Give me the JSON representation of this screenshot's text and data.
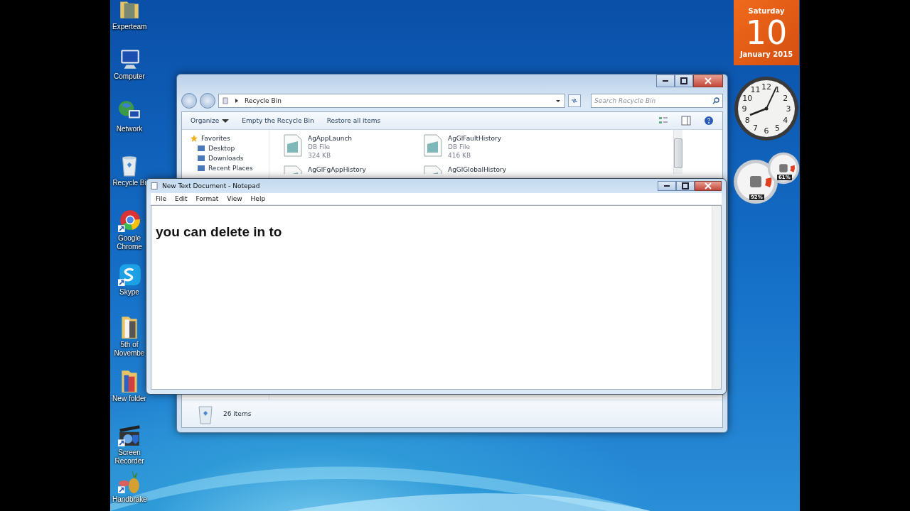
{
  "desktop_icons": [
    {
      "label": "Experteam"
    },
    {
      "label": "Computer"
    },
    {
      "label": "Network"
    },
    {
      "label": "Recycle Bi"
    },
    {
      "label": "Google Chrome"
    },
    {
      "label": "Skype"
    },
    {
      "label": "5th of Novembe"
    },
    {
      "label": "New folder"
    },
    {
      "label": "Screen Recorder"
    },
    {
      "label": "Handbrake"
    }
  ],
  "gadgets": {
    "calendar": {
      "weekday": "Saturday",
      "day": "10",
      "month_year": "January 2015"
    },
    "clock": {
      "numerals": [
        "11",
        "12",
        "1",
        "10",
        "2",
        "9",
        "3",
        "8",
        "4",
        "7",
        "6",
        "5"
      ]
    },
    "meters": [
      {
        "reading": "92%"
      },
      {
        "reading": "61%"
      }
    ]
  },
  "explorer": {
    "address": "Recycle Bin",
    "search": {
      "placeholder": "Search Recycle Bin"
    },
    "toolbar": [
      "Organize",
      "Empty the Recycle Bin",
      "Restore all items"
    ],
    "sidebar": {
      "heading": "Favorites",
      "items": [
        "Desktop",
        "Downloads",
        "Recent Places"
      ]
    },
    "files": [
      {
        "name": "AgAppLaunch",
        "type": "DB File",
        "size": "324 KB"
      },
      {
        "name": "AgGlFaultHistory",
        "type": "DB File",
        "size": "416 KB"
      },
      {
        "name": "AgGlFgAppHistory"
      },
      {
        "name": "AgGlGlobalHistory"
      }
    ],
    "status": "26 items"
  },
  "notepad": {
    "title": "New Text Document - Notepad",
    "menu": [
      "File",
      "Edit",
      "Format",
      "View",
      "Help"
    ],
    "text": "you can delete in to"
  }
}
